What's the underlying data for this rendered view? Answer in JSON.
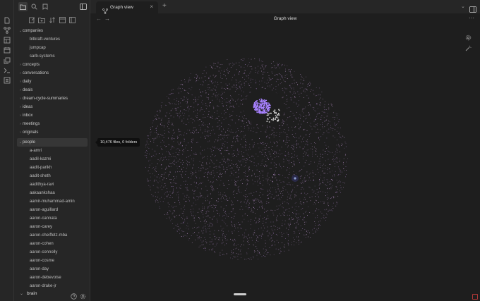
{
  "sidebar": {
    "items": [
      {
        "label": "companies",
        "expanded": true,
        "level": 0
      },
      {
        "label": "bitkraft-ventures",
        "level": 1
      },
      {
        "label": "jumpcap",
        "level": 1
      },
      {
        "label": "sarb-systems",
        "level": 1
      },
      {
        "label": "concepts",
        "level": 0
      },
      {
        "label": "conversations",
        "level": 0
      },
      {
        "label": "daily",
        "level": 0
      },
      {
        "label": "deals",
        "level": 0
      },
      {
        "label": "dream-cycle-summaries",
        "level": 0
      },
      {
        "label": "ideas",
        "level": 0
      },
      {
        "label": "inbox",
        "level": 0
      },
      {
        "label": "meetings",
        "level": 0
      },
      {
        "label": "originals",
        "level": 0
      },
      {
        "label": "people",
        "expanded": true,
        "level": 0,
        "selected": true
      },
      {
        "label": "a-amri",
        "level": 1
      },
      {
        "label": "aadil-kazmi",
        "level": 1
      },
      {
        "label": "aadit-parikh",
        "level": 1
      },
      {
        "label": "aadit-sheth",
        "level": 1
      },
      {
        "label": "aadithya-ravi",
        "level": 1
      },
      {
        "label": "aakaankshaa",
        "level": 1
      },
      {
        "label": "aamir-muhammad-amin",
        "level": 1
      },
      {
        "label": "aaron-aguillard",
        "level": 1
      },
      {
        "label": "aaron-cannata",
        "level": 1
      },
      {
        "label": "aaron-carey",
        "level": 1
      },
      {
        "label": "aaron-cheiffetz-mba",
        "level": 1
      },
      {
        "label": "aaron-cohen",
        "level": 1
      },
      {
        "label": "aaron-connolly",
        "level": 1
      },
      {
        "label": "aaron-cosme",
        "level": 1
      },
      {
        "label": "aaron-day",
        "level": 1
      },
      {
        "label": "aaron-debevoise",
        "level": 1
      },
      {
        "label": "aaron-drake-jr",
        "level": 1
      }
    ],
    "vault_name": "brain"
  },
  "tabs": [
    {
      "label": "Graph view",
      "active": true
    }
  ],
  "view": {
    "title": "Graph view"
  },
  "tooltip": {
    "text": "10,476 files, 0 folders"
  },
  "icons": {
    "ribbon": [
      "files-icon",
      "graph-icon",
      "canvas-icon",
      "calendar-icon",
      "copy-icon",
      "terminal-icon",
      "list-icon"
    ],
    "accent": "#a882ff",
    "node_color": "#c39bd3"
  }
}
